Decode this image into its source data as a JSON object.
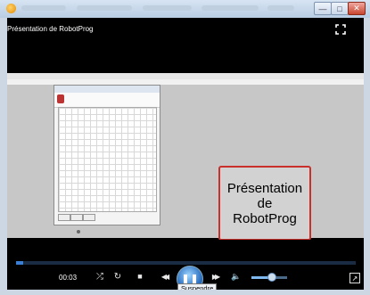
{
  "window": {
    "video_title": "Présentation de RobotProg",
    "buttons": {
      "minimize": "—",
      "maximize": "□",
      "close": "✕"
    }
  },
  "slide": {
    "callout_lines": [
      "Présentation",
      "de",
      "RobotProg"
    ],
    "callout_border_color": "#c9302c"
  },
  "player": {
    "time": "00:03",
    "progress": 0.02,
    "volume": 0.55,
    "tooltip": "Suspendre",
    "icons": {
      "shuffle": "shuffle-icon",
      "repeat": "repeat-icon",
      "stop": "stop-icon",
      "previous": "previous-icon",
      "pause": "pause-icon",
      "next": "next-icon",
      "mute": "speaker-icon",
      "switch": "switch-to-library-icon",
      "fullscreen": "fullscreen-icon"
    },
    "glyphs": {
      "shuffle": "⤮",
      "repeat": "↻",
      "stop": "■",
      "previous": "◀◀",
      "pause": "❚❚",
      "next": "▶▶",
      "mute": "🔈",
      "switch": "↗"
    }
  },
  "colors": {
    "accent": "#3b7fd4",
    "background": "#000000"
  }
}
